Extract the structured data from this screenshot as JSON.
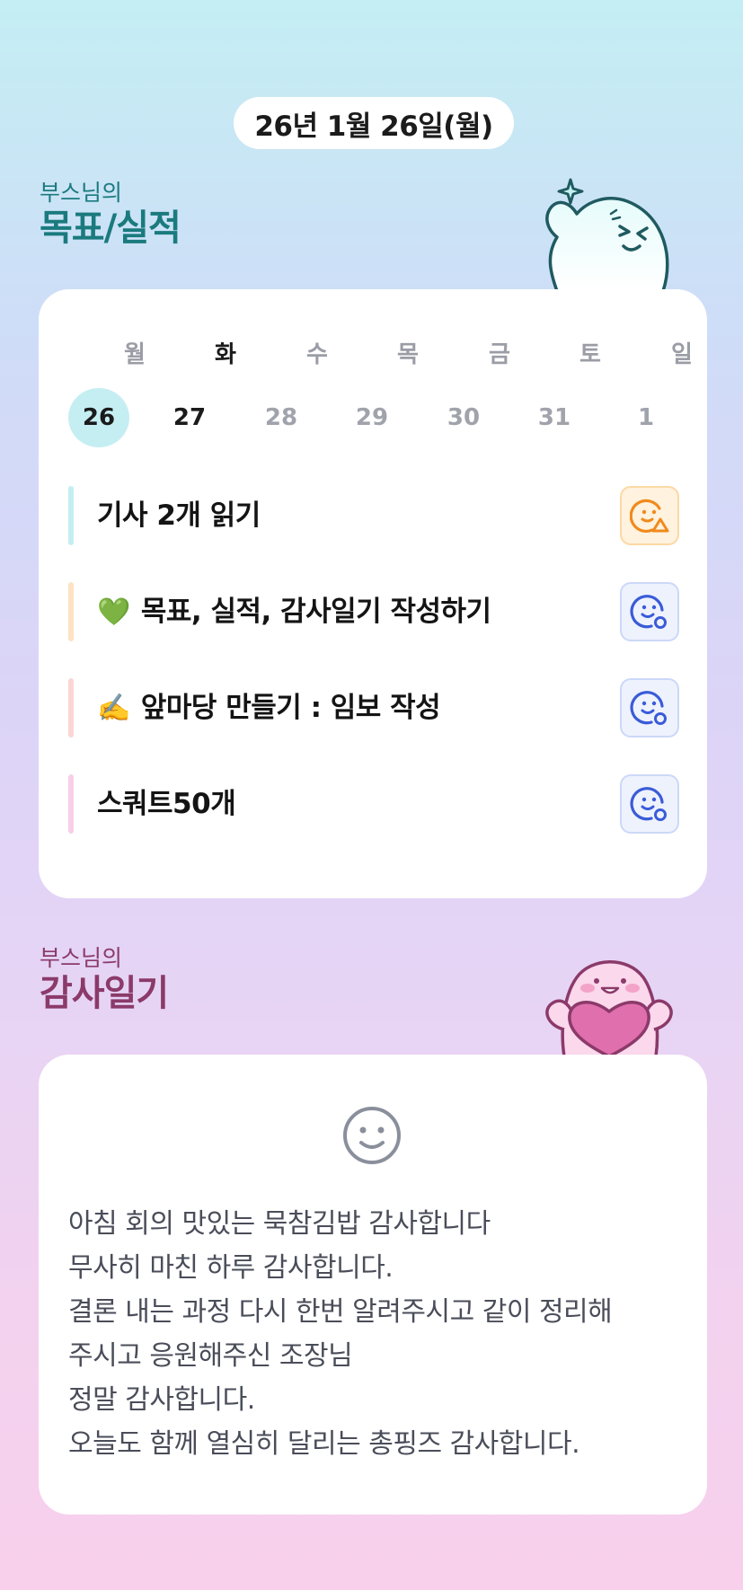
{
  "header": {
    "date": "26년 1월 26일(월)"
  },
  "goals_section": {
    "owner": "부스님의",
    "title": "목표/실적"
  },
  "week": {
    "days": [
      {
        "dow": "월",
        "num": "26",
        "state": "today"
      },
      {
        "dow": "화",
        "num": "27",
        "state": "strong"
      },
      {
        "dow": "수",
        "num": "28",
        "state": "muted"
      },
      {
        "dow": "목",
        "num": "29",
        "state": "muted"
      },
      {
        "dow": "금",
        "num": "30",
        "state": "muted"
      },
      {
        "dow": "토",
        "num": "31",
        "state": "muted"
      },
      {
        "dow": "일",
        "num": "1",
        "state": "muted"
      }
    ]
  },
  "goals": [
    {
      "emoji": "",
      "text": "기사 2개 읽기",
      "bar_color": "#c5eef3",
      "status": "warn",
      "status_icon": "face-warning-icon"
    },
    {
      "emoji": "💚",
      "text": "목표, 실적, 감사일기 작성하기",
      "bar_color": "#fde2c4",
      "status": "ok",
      "status_icon": "face-check-icon"
    },
    {
      "emoji": "✍️",
      "text": "앞마당 만들기 : 임보 작성",
      "bar_color": "#fbd6d6",
      "status": "ok",
      "status_icon": "face-check-icon"
    },
    {
      "emoji": "",
      "text": "스쿼트50개",
      "bar_color": "#f8cfe8",
      "status": "ok",
      "status_icon": "face-check-icon"
    }
  ],
  "thanks_section": {
    "owner": "부스님의",
    "title": "감사일기"
  },
  "thanks": {
    "mood_icon": "smile-face-icon",
    "lines": [
      "아침 회의 맛있는 묵참김밥 감사합니다",
      "무사히 마친 하루 감사합니다.",
      "결론 내는 과정 다시 한번 알려주시고 같이 정리해",
      "주시고 응원해주신 조장님",
      "정말 감사합니다.",
      "오늘도 함께 열심히 달리는 총핑즈 감사합니다."
    ]
  },
  "colors": {
    "teal": "#1a7a7e",
    "plum": "#8b3a6a",
    "today": "#c5eef3",
    "warn": "#f08a1c",
    "ok": "#3a5bd9"
  }
}
